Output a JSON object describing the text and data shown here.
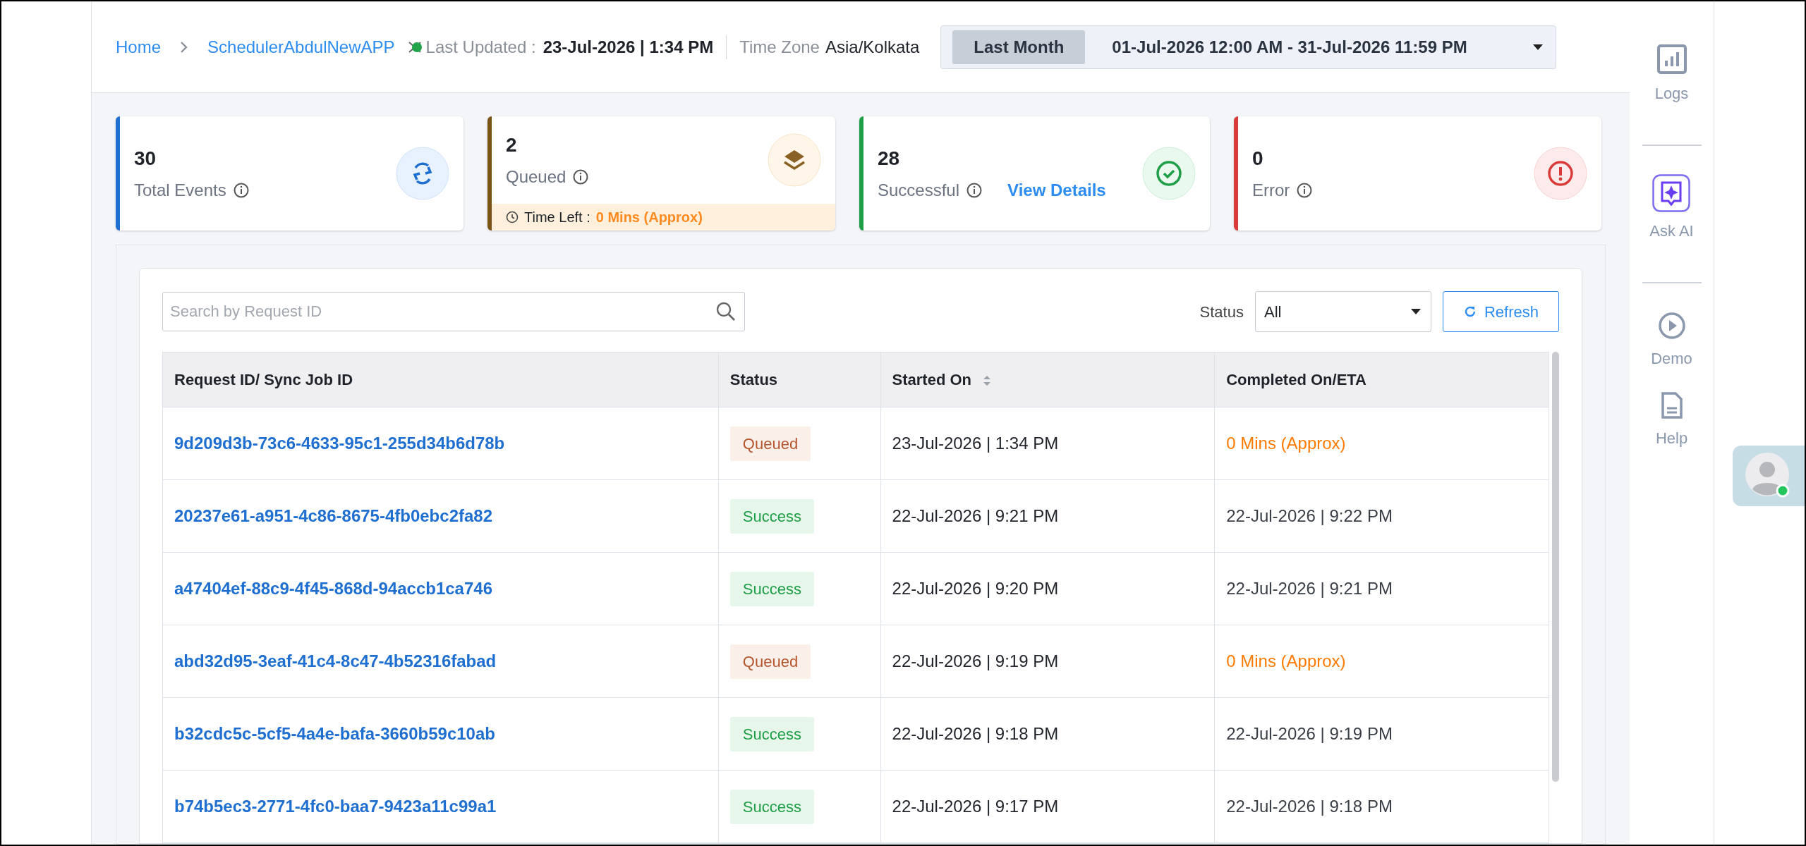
{
  "breadcrumb": [
    "Home",
    "SchedulerAbdulNewAPP"
  ],
  "header": {
    "last_updated_label": "Last Updated :",
    "last_updated": "23-Jul-2026 | 1:34 PM",
    "timezone_label": "Time Zone",
    "timezone": "Asia/Kolkata",
    "range_preset": "Last Month",
    "range": "01-Jul-2026 12:00 AM - 31-Jul-2026 11:59 PM"
  },
  "cards": [
    {
      "kind": "total",
      "value": "30",
      "label": "Total Events",
      "color": "#1f6fd1"
    },
    {
      "kind": "queued",
      "value": "2",
      "label": "Queued",
      "color": "#7a5417",
      "time_left_label": "Time Left :",
      "time_left": "0 Mins (Approx)"
    },
    {
      "kind": "success",
      "value": "28",
      "label": "Successful",
      "color": "#1e9e46",
      "link": "View Details"
    },
    {
      "kind": "error",
      "value": "0",
      "label": "Error",
      "color": "#d93a3a"
    }
  ],
  "search": {
    "placeholder": "Search by Request ID"
  },
  "status_filter": {
    "label": "Status",
    "value": "All"
  },
  "refresh": "Refresh",
  "table": {
    "columns": [
      "Request ID/ Sync Job ID",
      "Status",
      "Started On",
      "Completed On/ETA"
    ],
    "rows": [
      {
        "id": "9d209d3b-73c6-4633-95c1-255d34b6d78b",
        "status": "Queued",
        "kind": "queued",
        "started": "23-Jul-2026 | 1:34 PM",
        "completed": "0 Mins (Approx)"
      },
      {
        "id": "20237e61-a951-4c86-8675-4fb0ebc2fa82",
        "status": "Success",
        "kind": "success",
        "started": "22-Jul-2026 | 9:21 PM",
        "completed": "22-Jul-2026 | 9:22 PM"
      },
      {
        "id": "a47404ef-88c9-4f45-868d-94accb1ca746",
        "status": "Success",
        "kind": "success",
        "started": "22-Jul-2026 | 9:20 PM",
        "completed": "22-Jul-2026 | 9:21 PM"
      },
      {
        "id": "abd32d95-3eaf-41c4-8c47-4b52316fabad",
        "status": "Queued",
        "kind": "queued",
        "started": "22-Jul-2026 | 9:19 PM",
        "completed": "0 Mins (Approx)"
      },
      {
        "id": "b32cdc5c-5cf5-4a4e-bafa-3660b59c10ab",
        "status": "Success",
        "kind": "success",
        "started": "22-Jul-2026 | 9:18 PM",
        "completed": "22-Jul-2026 | 9:19 PM"
      },
      {
        "id": "b74b5ec3-2771-4fc0-baa7-9423a11c99a1",
        "status": "Success",
        "kind": "success",
        "started": "22-Jul-2026 | 9:17 PM",
        "completed": "22-Jul-2026 | 9:18 PM"
      }
    ]
  },
  "sidebar": [
    {
      "kind": "logs",
      "label": "Logs"
    },
    {
      "kind": "ai",
      "label": "Ask AI"
    },
    {
      "kind": "demo",
      "label": "Demo"
    },
    {
      "kind": "help",
      "label": "Help"
    }
  ]
}
